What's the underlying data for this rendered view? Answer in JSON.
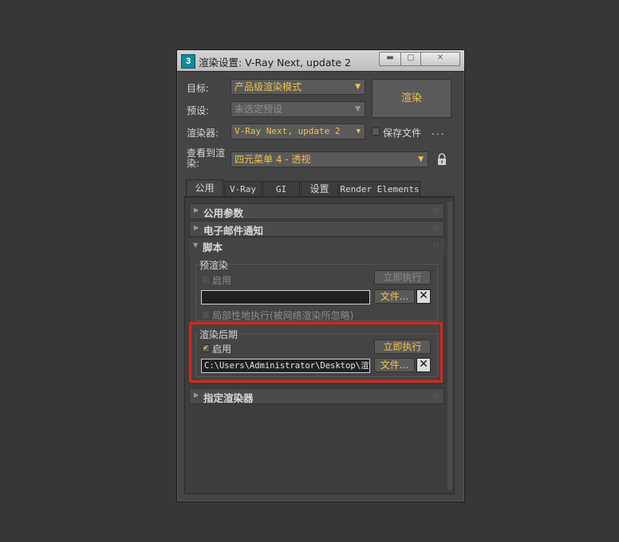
{
  "window": {
    "title": "渲染设置: V-Ray Next, update 2",
    "app_icon": "3"
  },
  "labels": {
    "target": "目标:",
    "preset": "预设:",
    "renderer": "渲染器:",
    "view_to_render": "查看到渲\n染:"
  },
  "target_value": "产品级渲染模式",
  "preset_value": "未选定预设",
  "renderer_value": "V-Ray Next, update 2",
  "view_value": "四元菜单 4 - 透视",
  "render_button": "渲染",
  "save_file": {
    "label": "保存文件",
    "checked": false
  },
  "dots": "...",
  "tabs": [
    "公用",
    "V-Ray",
    "GI",
    "设置",
    "Render Elements"
  ],
  "active_tab": "公用",
  "rollouts": {
    "common_params": "公用参数",
    "email": "电子邮件通知",
    "scripts": "脚本",
    "assign_renderer": "指定渲染器"
  },
  "pre_render": {
    "title": "预渲染",
    "enable_label": "启用",
    "enabled": false,
    "execute_now": "立即执行",
    "file_button": "文件...",
    "path": "",
    "local_exec": "局部性地执行(被网络渲染所忽略)"
  },
  "post_render": {
    "title": "渲染后期",
    "enable_label": "启用",
    "enabled": true,
    "execute_now": "立即执行",
    "file_button": "文件...",
    "path": "C:\\Users\\Administrator\\Desktop\\渲染"
  },
  "colors": {
    "accent": "#f2c14e",
    "highlight": "#d8251c"
  }
}
